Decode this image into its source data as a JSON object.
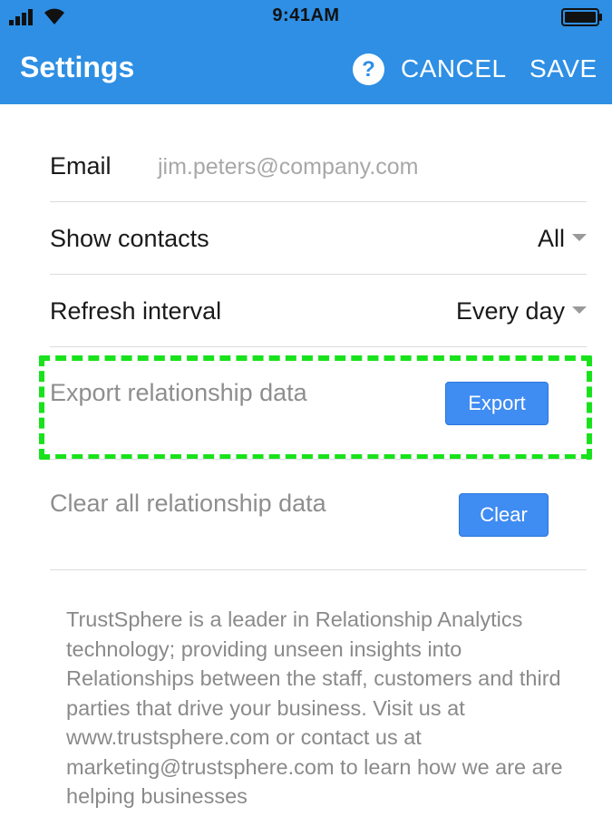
{
  "status_bar": {
    "time": "9:41AM"
  },
  "header": {
    "title": "Settings",
    "help_icon_glyph": "?",
    "cancel_label": "CANCEL",
    "save_label": "SAVE",
    "background_color": "#2e8fe4"
  },
  "settings": {
    "email": {
      "label": "Email",
      "value": "jim.peters@company.com"
    },
    "show_contacts": {
      "label": "Show contacts",
      "selected": "All"
    },
    "refresh_interval": {
      "label": "Refresh interval",
      "selected": "Every day"
    },
    "export": {
      "label": "Export relationship data",
      "button_label": "Export"
    },
    "clear": {
      "label": "Clear all relationship data",
      "button_label": "Clear"
    }
  },
  "about": {
    "text": "TrustSphere is a leader in Relationship Analytics technology; providing unseen insights into Relationships between the staff, customers and third parties that drive your business. Visit us at www.trustsphere.com or contact us at marketing@trustsphere.com to learn how we are are helping businesses"
  },
  "colors": {
    "accent": "#2e8fe4",
    "button": "#3f8cf2",
    "highlight": "#18e21b"
  },
  "icons": [
    "cellular-signal-icon",
    "wifi-icon",
    "battery-icon",
    "help-icon",
    "dropdown-caret-icon"
  ]
}
